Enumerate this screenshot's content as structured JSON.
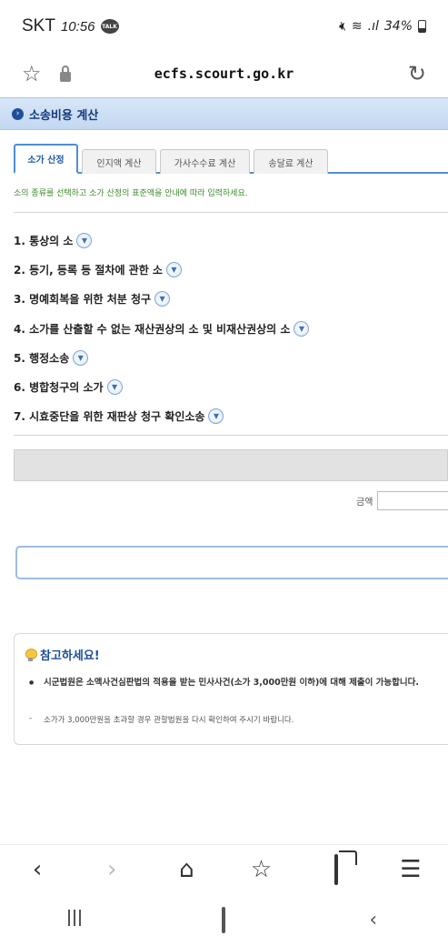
{
  "status_bar": {
    "carrier": "SKT",
    "time": "10:56",
    "talk_icon": "TALK",
    "battery": "34%",
    "icons": [
      "kakaotalk-icon",
      "mute-icon",
      "wifi-icon",
      "signal-icon",
      "battery-icon"
    ]
  },
  "browser": {
    "url": "ecfs.scourt.go.kr",
    "icons": [
      "bookmark-star-icon",
      "lock-icon",
      "reload-icon"
    ]
  },
  "page": {
    "title": "소송비용 계산",
    "tabs": [
      {
        "label": "소가 산정",
        "active": true
      },
      {
        "label": "인지액 계산",
        "active": false
      },
      {
        "label": "가사수수료 계산",
        "active": false
      },
      {
        "label": "송달료 계산",
        "active": false
      }
    ],
    "instruction": "소의 종류를 선택하고 소가 산정의 표준액을 안내에 따라 입력하세요.",
    "categories": [
      "1. 통상의 소",
      "2. 등기, 등록 등 절차에 관한 소",
      "3. 명예회복을 위한 처분 청구",
      "4. 소가를 산출할 수 없는 재산권상의 소 및 비재산권상의 소",
      "5. 행정소송",
      "6. 병합청구의 소가",
      "7. 시효중단을 위한 재판상 청구 확인소송"
    ],
    "amount_label": "금액",
    "amount_value": "",
    "notice": {
      "title": "참고하세요!",
      "bullet": "시군법원은 소액사건심판법의 적용을 받는 민사사건(소가 3,000만원 이하)에 대해 제출이 가능합니다.",
      "note": "소가가 3,000만원을 초과할 경우 관할법원을 다시 확인하여 주시기 바랍니다."
    }
  },
  "browser_nav": [
    "back-icon",
    "forward-icon",
    "home-icon",
    "bookmarks-icon",
    "tabs-icon",
    "menu-icon"
  ],
  "colors": {
    "accent": "#4d8ed4",
    "header_bg": "#c3d8f2",
    "title_text": "#123a7a",
    "instruction_text": "#3a8a2a"
  }
}
